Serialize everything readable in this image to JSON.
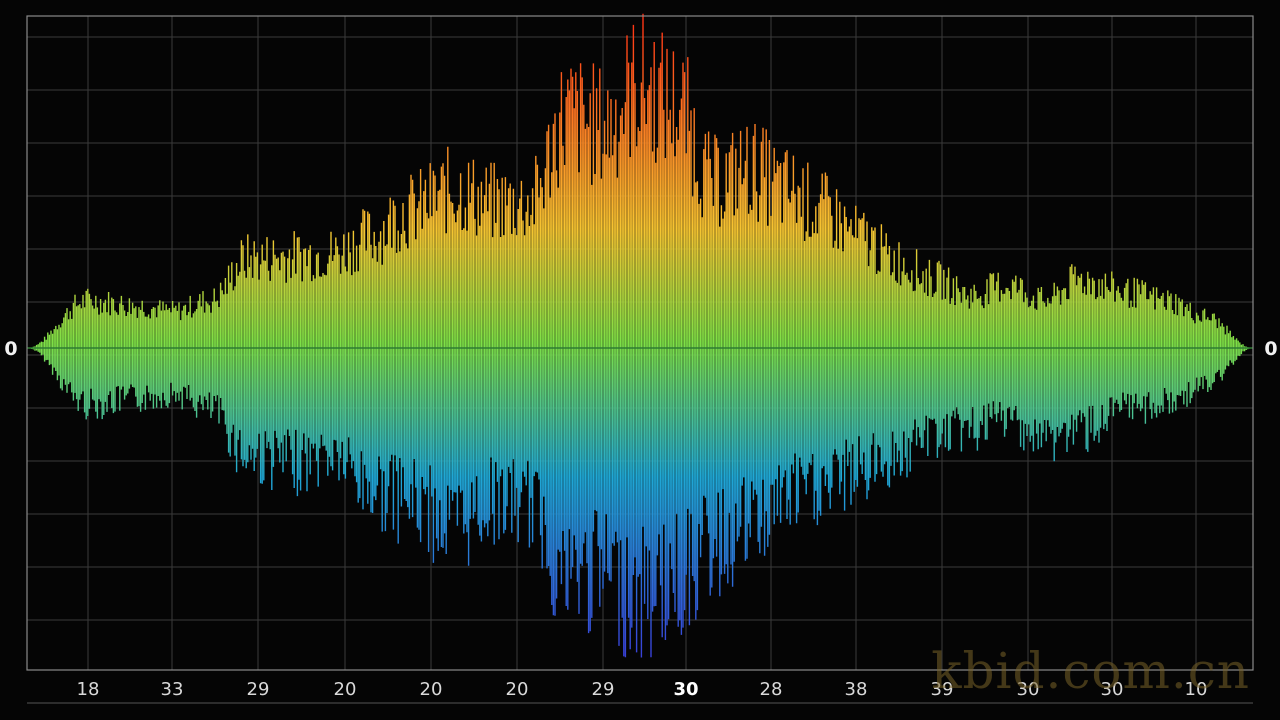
{
  "chart_data": {
    "type": "area",
    "title": "",
    "xlabel": "",
    "ylabel": "",
    "grid": true,
    "legend": "none",
    "y_zero_label": "0",
    "ylim": [
      -1,
      1
    ],
    "x_tick_labels": [
      "18",
      "33",
      "29",
      "20",
      "20",
      "20",
      "29",
      "30",
      "28",
      "38",
      "39",
      "30",
      "30",
      "10"
    ],
    "highlighted_tick_index": 7,
    "envelope": {
      "x": [
        0,
        0.05,
        0.09,
        0.12,
        0.15,
        0.18,
        0.22,
        0.25,
        0.28,
        0.31,
        0.35,
        0.38,
        0.41,
        0.44,
        0.47,
        0.5,
        0.53,
        0.56,
        0.59,
        0.62,
        0.65,
        0.68,
        0.71,
        0.74,
        0.77,
        0.8,
        0.83,
        0.86,
        0.9,
        0.93,
        0.96,
        1.0
      ],
      "upper": [
        0.0,
        0.18,
        0.16,
        0.14,
        0.18,
        0.34,
        0.35,
        0.36,
        0.42,
        0.52,
        0.6,
        0.55,
        0.55,
        0.88,
        0.84,
        1.0,
        0.92,
        0.63,
        0.68,
        0.6,
        0.52,
        0.42,
        0.33,
        0.26,
        0.2,
        0.24,
        0.18,
        0.26,
        0.21,
        0.18,
        0.12,
        0.0
      ],
      "lower": [
        0.0,
        -0.22,
        -0.2,
        -0.18,
        -0.24,
        -0.42,
        -0.45,
        -0.42,
        -0.55,
        -0.6,
        -0.7,
        -0.6,
        -0.62,
        -0.9,
        -0.88,
        -0.98,
        -0.9,
        -0.78,
        -0.7,
        -0.58,
        -0.55,
        -0.48,
        -0.42,
        -0.34,
        -0.32,
        -0.28,
        -0.36,
        -0.32,
        -0.24,
        -0.22,
        -0.15,
        0.0
      ]
    },
    "colors": {
      "background": "#050505",
      "grid": "#3a3a3a",
      "frame": "#8a8a8a",
      "zero_line": "#2e7d32",
      "gradient_top": "#ff2a12",
      "gradient_upper": "#f7c531",
      "gradient_mid": "#7ee046",
      "gradient_lower": "#1fa8d6",
      "gradient_bottom": "#3b34d9"
    }
  },
  "watermark": "kbid.com.cn"
}
